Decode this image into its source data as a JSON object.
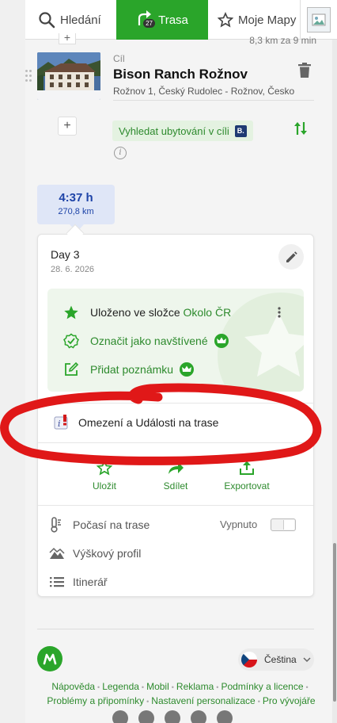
{
  "tabs": {
    "search_label": "Hledání",
    "route_label": "Trasa",
    "route_badge": "27",
    "maps_label": "Moje Mapy"
  },
  "segment_above": "8,3 km za 9 min",
  "destination": {
    "label": "Cíl",
    "title": "Bison Ranch Rožnov",
    "address": "Rožnov 1, Český Rudolec - Rožnov, Česko",
    "accommodation_label": "Vyhledat ubytování v cíli",
    "booking_badge": "B."
  },
  "summary": {
    "time": "4:37 h",
    "distance": "270,8 km"
  },
  "day": {
    "title": "Day 3",
    "date": "28. 6. 2026",
    "saved_prefix": "Uloženo ve složce ",
    "saved_folder": "Okolo ČR",
    "mark_visited": "Označit jako navštívené",
    "add_note": "Přidat poznámku"
  },
  "restrictions_label": "Omezení a Události na trase",
  "actions": {
    "save": "Uložit",
    "share": "Sdílet",
    "export": "Exportovat"
  },
  "options": {
    "weather": "Počasí na trase",
    "weather_state": "Vypnuto",
    "elevation": "Výškový profil",
    "itinerary": "Itinerář"
  },
  "footer": {
    "language": "Čeština",
    "links_row1": [
      "Nápověda",
      "Legenda",
      "Mobil",
      "Reklama",
      "Podmínky a licence"
    ],
    "links_row2": [
      "Problémy a připomínky",
      "Nastavení personalizace",
      "Pro vývojáře"
    ]
  },
  "colors": {
    "brand_green": "#2aa52a",
    "link_green": "#2d8a2d",
    "summary_blue": "#1e44a8",
    "annotation_red": "#e01818"
  },
  "icons": [
    "search-icon",
    "route-icon",
    "star-icon",
    "trash-icon",
    "swap-icon",
    "info-icon",
    "edit-icon",
    "kebab-icon",
    "check-icon",
    "note-icon",
    "crown-icon",
    "warning-icon",
    "share-icon",
    "export-icon",
    "thermometer-icon",
    "mountain-icon",
    "list-icon"
  ]
}
